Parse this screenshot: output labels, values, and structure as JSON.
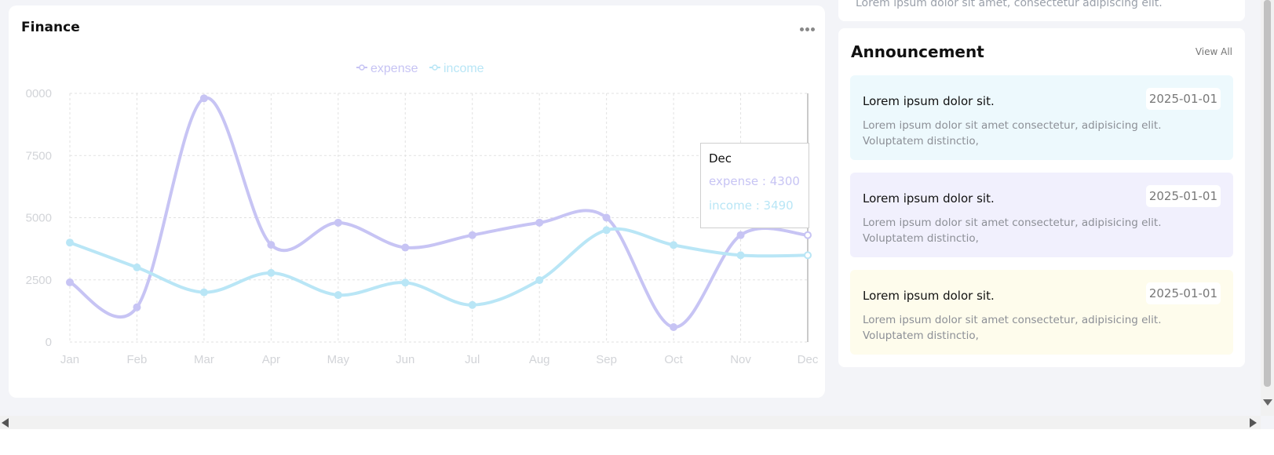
{
  "colors": {
    "expense": "#c7c4f4",
    "income": "#b9e6f6"
  },
  "top_strip": {
    "text": "Lorem ipsum dolor sit amet, consectetur adipiscing elit."
  },
  "finance": {
    "title": "Finance",
    "more_icon": "more-horizontal-icon",
    "legend": {
      "expense": "expense",
      "income": "income"
    },
    "tooltip": {
      "title": "Dec",
      "expense": "expense : 4300",
      "income": "income : 3490"
    }
  },
  "chart_data": {
    "type": "line",
    "categories": [
      "Jan",
      "Feb",
      "Mar",
      "Apr",
      "May",
      "Jun",
      "Jul",
      "Aug",
      "Sep",
      "Oct",
      "Nov",
      "Dec"
    ],
    "series": [
      {
        "name": "expense",
        "color": "#c7c4f4",
        "values": [
          2400,
          1398,
          9800,
          3908,
          4800,
          3800,
          4300,
          4800,
          5000,
          600,
          4300,
          4300
        ]
      },
      {
        "name": "income",
        "color": "#b9e6f6",
        "values": [
          4000,
          3000,
          2000,
          2780,
          1890,
          2390,
          1490,
          2490,
          4500,
          3900,
          3490,
          3490
        ]
      }
    ],
    "yticks": [
      "0",
      "2500",
      "5000",
      "7500",
      "0000"
    ],
    "ylim": [
      0,
      10000
    ],
    "grid": true,
    "legend_position": "top-center"
  },
  "announcements": {
    "title": "Announcement",
    "view_all": "View All",
    "items": [
      {
        "title": "Lorem ipsum dolor sit.",
        "date": "2025-01-01",
        "desc": "Lorem ipsum dolor sit amet consectetur, adipisicing elit. Voluptatem distinctio,",
        "bg": "#edf9fd"
      },
      {
        "title": "Lorem ipsum dolor sit.",
        "date": "2025-01-01",
        "desc": "Lorem ipsum dolor sit amet consectetur, adipisicing elit. Voluptatem distinctio,",
        "bg": "#f1f0fd"
      },
      {
        "title": "Lorem ipsum dolor sit.",
        "date": "2025-01-01",
        "desc": "Lorem ipsum dolor sit amet consectetur, adipisicing elit. Voluptatem distinctio,",
        "bg": "#fefcec"
      }
    ]
  }
}
